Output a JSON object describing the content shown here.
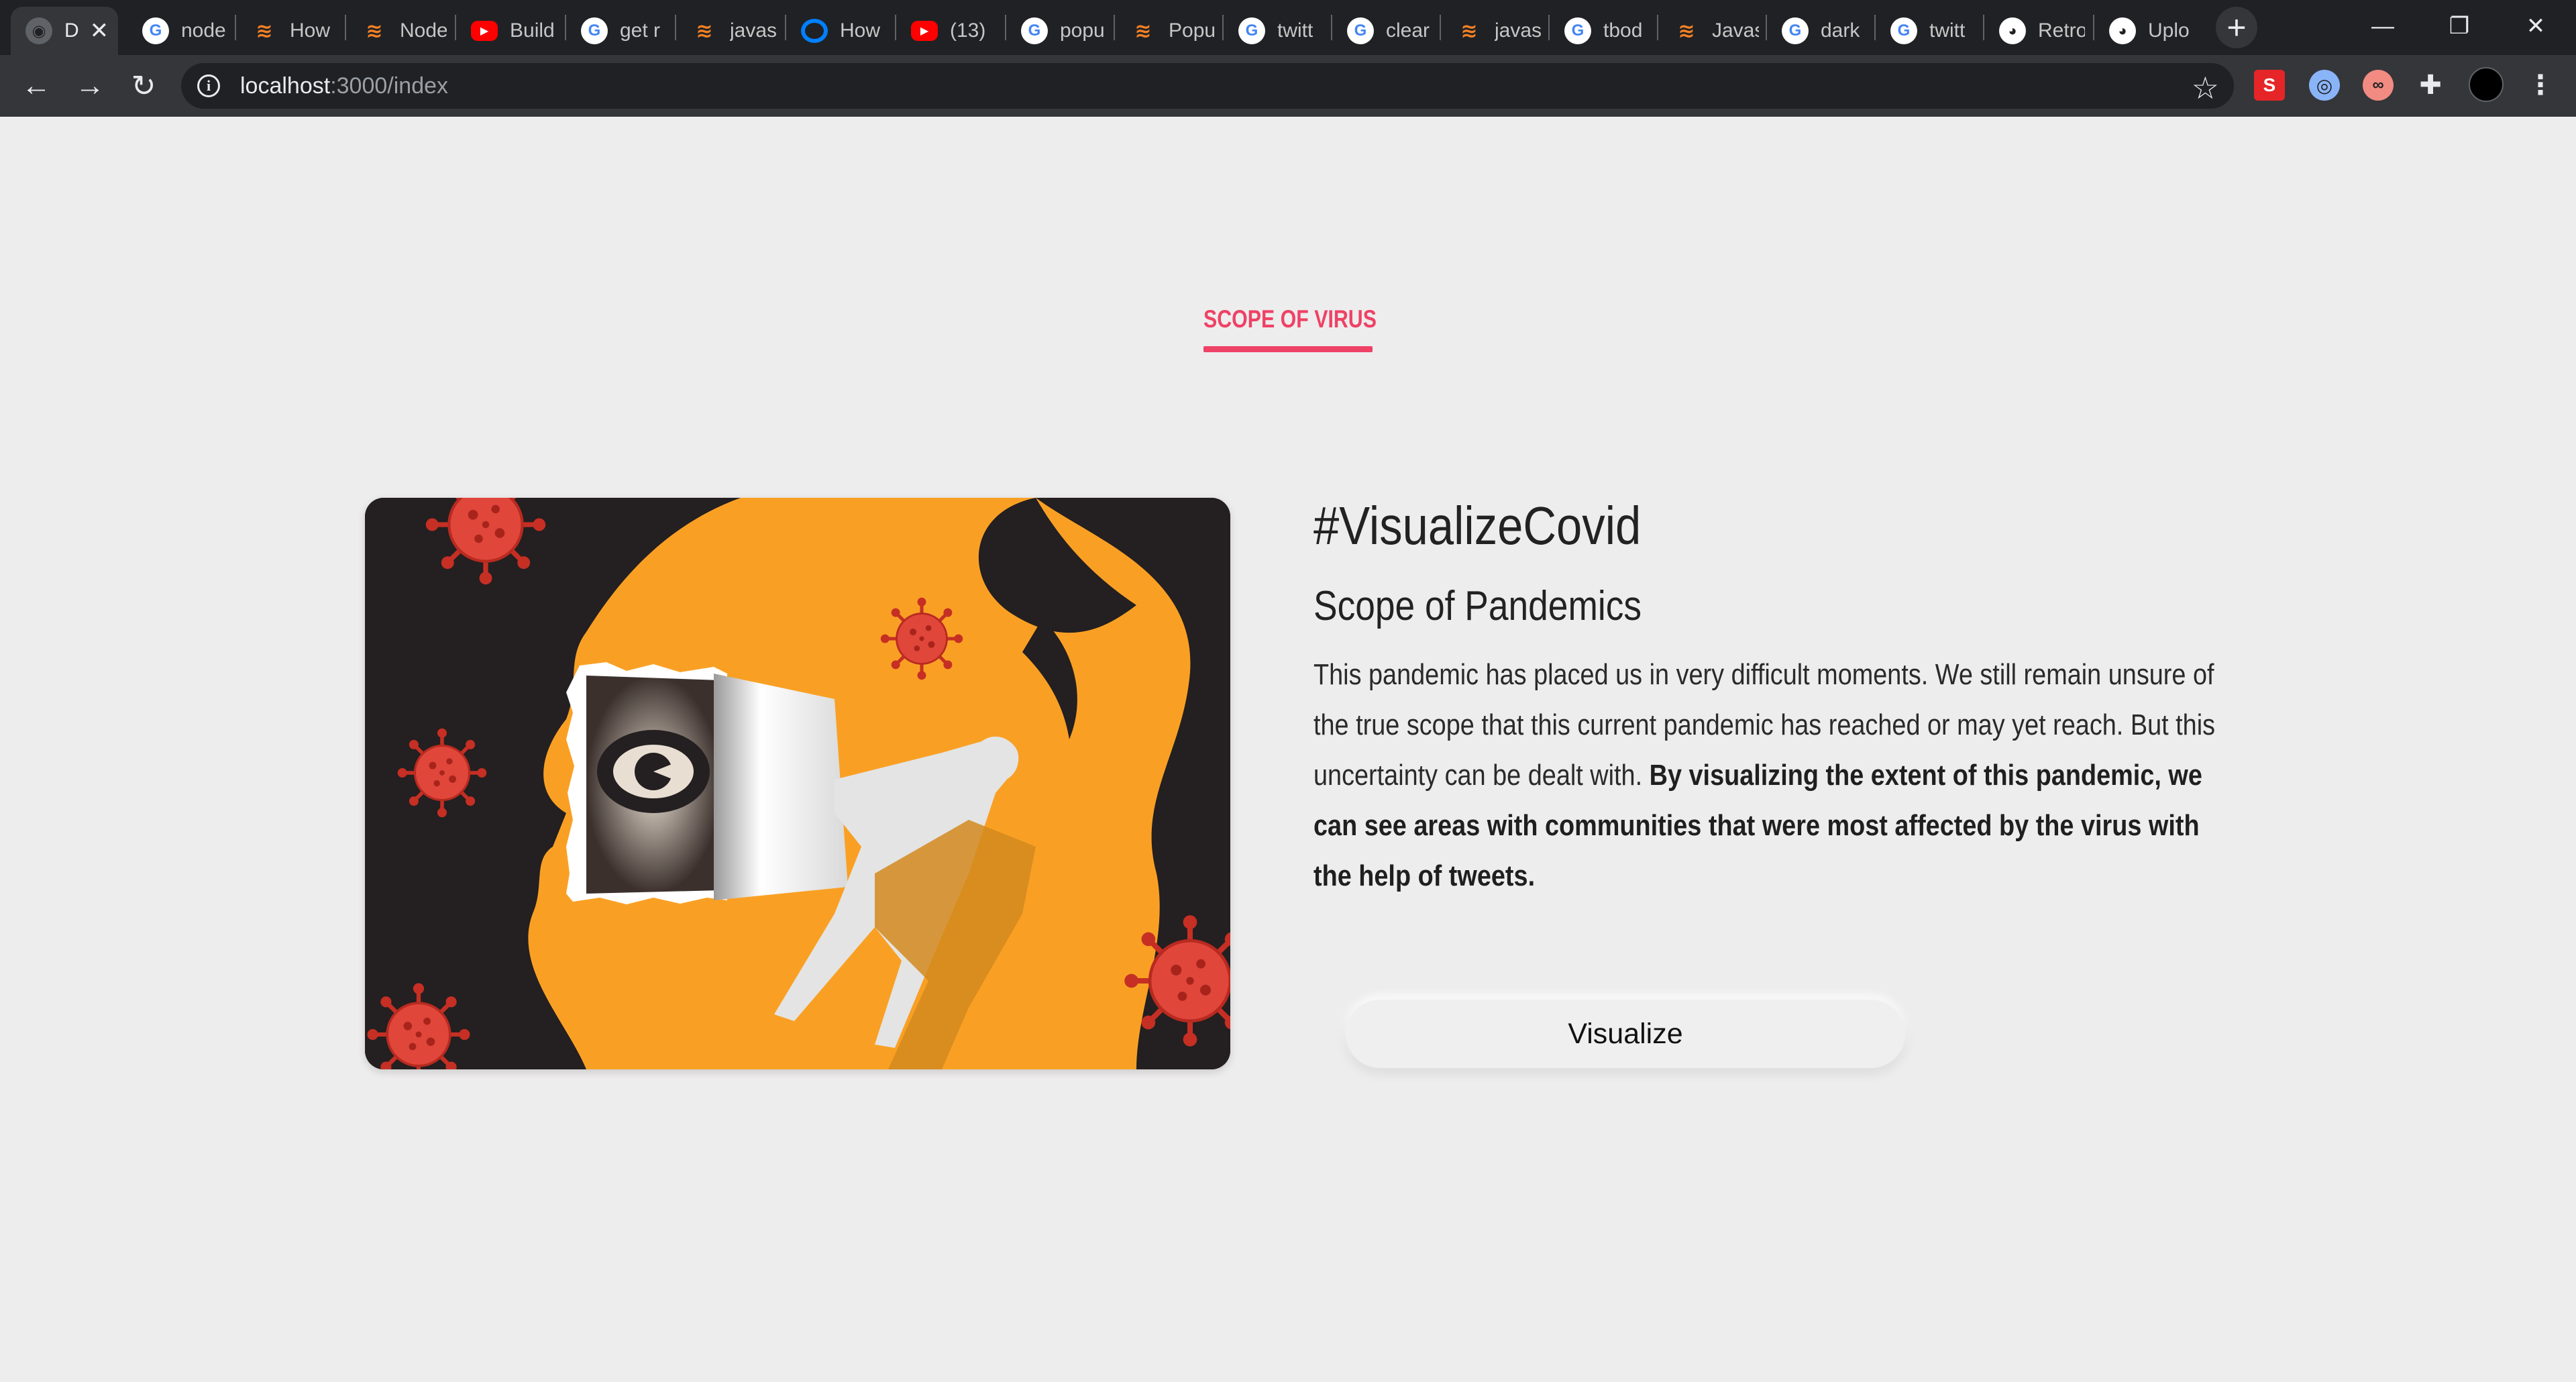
{
  "browser": {
    "tabs": [
      {
        "label": "D",
        "favicon": "globe-icon"
      },
      {
        "label": "node",
        "favicon": "google-icon"
      },
      {
        "label": "How",
        "favicon": "stackoverflow-icon"
      },
      {
        "label": "Node",
        "favicon": "stackoverflow-icon"
      },
      {
        "label": "Build",
        "favicon": "youtube-icon"
      },
      {
        "label": "get r",
        "favicon": "google-icon"
      },
      {
        "label": "javas",
        "favicon": "stackoverflow-icon"
      },
      {
        "label": "How",
        "favicon": "digitalocean-icon"
      },
      {
        "label": "(13)",
        "favicon": "youtube-icon"
      },
      {
        "label": "popu",
        "favicon": "google-icon"
      },
      {
        "label": "Popu",
        "favicon": "stackoverflow-icon"
      },
      {
        "label": "twitt",
        "favicon": "google-icon"
      },
      {
        "label": "clear",
        "favicon": "google-icon"
      },
      {
        "label": "javas",
        "favicon": "stackoverflow-icon"
      },
      {
        "label": "tbod",
        "favicon": "google-icon"
      },
      {
        "label": "Javas",
        "favicon": "stackoverflow-icon"
      },
      {
        "label": "dark",
        "favicon": "google-icon"
      },
      {
        "label": "twitt",
        "favicon": "google-icon"
      },
      {
        "label": "Retro",
        "favicon": "github-icon"
      },
      {
        "label": "Uplo",
        "favicon": "github-icon"
      }
    ],
    "url_host": "localhost",
    "url_path": ":3000/index",
    "colors": {
      "tabstrip": "#202124",
      "toolbar": "#35363a",
      "omnibox": "#202124"
    }
  },
  "page": {
    "section_label": "SCOPE OF VIRUS",
    "title": "#VisualizeCovid",
    "subtitle": "Scope of Pandemics",
    "body_plain": "This pandemic has placed us in very difficult moments. We still remain unsure of the true scope that this current pandemic has reached or may yet reach. But this uncertainty can be dealt with. ",
    "body_bold": "By visualizing the extent of this pandemic, we can see areas with communities that were most affected by the virus with the help of tweets.",
    "button_label": "Visualize",
    "colors": {
      "accent": "#ee4266",
      "background": "#eeeded",
      "illustration_orange": "#f9a024",
      "virus_red": "#d63a2c"
    }
  }
}
